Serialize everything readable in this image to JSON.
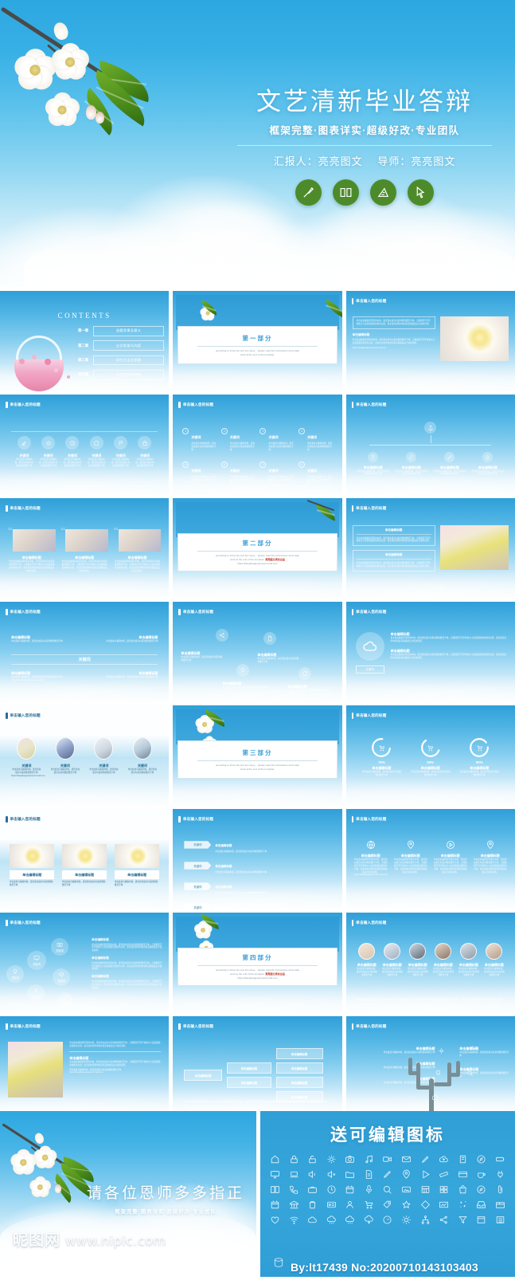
{
  "hero": {
    "title": "文艺清新毕业答辩",
    "subtitle": "框架完整·图表详实·超级好改·专业团队",
    "presenter_label": "汇报人：亮亮图文",
    "advisor_label": "导师：亮亮图文",
    "icons": [
      "brush-icon",
      "book-icon",
      "ruler-icon",
      "cursor-icon"
    ]
  },
  "common": {
    "slide_header": "单击输入您的标题",
    "keyword": "关键词",
    "edit_title": "单击编辑标题",
    "body_short": "单击此处可编辑内容，建议您在展示时采用微软雅黑字体",
    "body_long": "单击此处编辑您所需的内容，建议您在展示时采用微软雅黑字体，正确搭配不同字体和大小是版面视觉效果的关键，更多使用说明内容请您见模板最后方使用说明。",
    "email_url": "https://liangliangpowerpoint.mail.com"
  },
  "contents": {
    "title": "CONTENTS",
    "rows": [
      {
        "chapter": "第一章",
        "text": "选题背景及意义"
      },
      {
        "chapter": "第二章",
        "text": "论文框架与内容"
      },
      {
        "chapter": "第三章",
        "text": "研究方法及思路"
      },
      {
        "chapter": "第四章",
        "text": "论文总结及创新"
      }
    ]
  },
  "dividers": [
    {
      "title": "第一部分",
      "sub_line1": "according to show the text box  area，  please read the instructions and make",
      "sub_line2": "work at the end of the template."
    },
    {
      "title": "第二部分",
      "sub_line1": "according to show the text box  area，  please read the instructions and make",
      "sub_line2": "work at the end of the template.",
      "highlight": "亮亮图文原创出品",
      "url": "https://liangliangpowerpoint.mail.com"
    },
    {
      "title": "第三部分",
      "sub_line1": "according to show the text box  area，  please read the instructions and make",
      "sub_line2": "work at the end of the template."
    },
    {
      "title": "第四部分",
      "sub_line1": "according to show the text box  area，  please read the instructions and make",
      "sub_line2": "work at the end of the template.",
      "highlight": "亮亮图文原创出品",
      "url": "https://liangliangpowerpoint.mail.com"
    }
  ],
  "slides": {
    "icon_row": {
      "items": [
        "edit-icon",
        "gear-icon",
        "clock-icon",
        "refresh-icon",
        "flag-icon",
        "lock-icon"
      ]
    },
    "numbered": {
      "numbers": [
        "1",
        "2",
        "3",
        "4",
        "5",
        "6",
        "7",
        "8"
      ]
    },
    "org": {
      "top_icon": "anchor-icon",
      "nodes": [
        "trophy-icon",
        "leaf-icon",
        "feather-icon",
        "bell-icon"
      ]
    },
    "rings": {
      "values": [
        "75%",
        "60%",
        "90%"
      ],
      "icon": "cart-icon"
    },
    "arrow_list": {
      "tags": [
        "关键词",
        "关键词",
        "关键词",
        "关键词",
        "关键词"
      ]
    },
    "icon_cols": {
      "icons": [
        "globe-icon",
        "pin-icon",
        "play-icon",
        "pin-icon"
      ]
    },
    "bubbles": {
      "icons": [
        "bulb-icon",
        "monitor-icon",
        "camera-icon",
        "umbrella-icon",
        "person-icon",
        "brush-icon"
      ]
    },
    "tree": {
      "levels": [
        1,
        2,
        4
      ]
    }
  },
  "thanks": {
    "title": "请各位恩师多多指正",
    "subtitle": "框架完整·图表详实·超级好改·专业团队"
  },
  "icon_panel": {
    "title": "送可编辑图标",
    "icons": [
      "home-icon",
      "lock-icon",
      "unlock-icon",
      "gear-icon",
      "camera-icon",
      "music-icon",
      "video-icon",
      "mail-icon",
      "pen-icon",
      "cloud-upload-icon",
      "book-icon",
      "compass-icon",
      "battery-icon",
      "monitor-icon",
      "laptop-icon",
      "speaker-icon",
      "volume-icon",
      "folder-icon",
      "document-icon",
      "pencil-icon",
      "pin-icon",
      "play-icon",
      "ruler-icon",
      "card-icon",
      "cup-icon",
      "plug-icon",
      "book-open-icon",
      "phone-icon",
      "briefcase-icon",
      "clock-icon",
      "calendar-icon",
      "mic-icon",
      "search-icon",
      "image-icon",
      "grid-icon",
      "layout-icon",
      "bag-icon",
      "compass-icon",
      "clip-icon",
      "calendar-alt-icon",
      "bank-icon",
      "trash-icon",
      "id-icon",
      "user-icon",
      "cart-icon",
      "tag-icon",
      "star-icon",
      "diamond-icon",
      "chart-icon",
      "sparkle-icon",
      "inbox-icon",
      "box-icon",
      "heart-icon",
      "wifi-icon",
      "cloud-icon",
      "cloud-rain-icon",
      "cloud-snow-icon",
      "cloud-down-icon",
      "clock-dial-icon",
      "sun-icon",
      "share-node-icon",
      "share-icon",
      "filter-icon",
      "frame-icon",
      "list-icon"
    ]
  },
  "footer": {
    "logo": "昵图网",
    "url": "www.nipic.com",
    "byline": "By:lt17439 No:20200710143103403"
  }
}
